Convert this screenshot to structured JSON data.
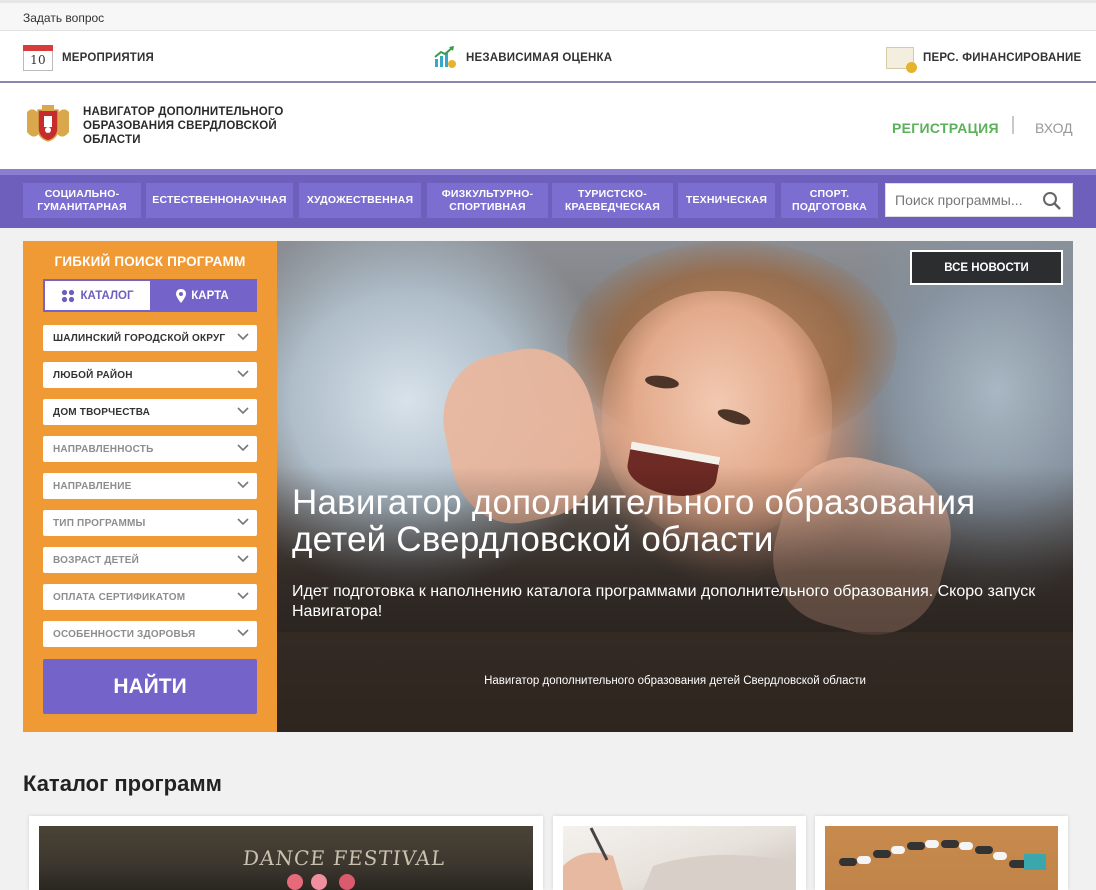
{
  "topbar": {
    "ask_link": "Задать вопрос"
  },
  "services": {
    "events": {
      "label": "МЕРОПРИЯТИЯ",
      "icon": "calendar-icon",
      "day": "10"
    },
    "rating": {
      "label": "НЕЗАВИСИМАЯ ОЦЕНКА",
      "icon": "chart-growth-icon"
    },
    "funding": {
      "label": "ПЕРС. ФИНАНСИРОВАНИЕ",
      "icon": "certificate-icon"
    }
  },
  "header": {
    "logo_icon": "coat-of-arms-icon",
    "logo_text": "НАВИГАТОР ДОПОЛНИТЕЛЬНОГО ОБРАЗОВАНИЯ СВЕРДЛОВСКОЙ ОБЛАСТИ",
    "register_label": "РЕГИСТРАЦИЯ",
    "login_label": "ВХОД",
    "colors": {
      "register": "#5bb15a",
      "login": "#999999"
    }
  },
  "nav": {
    "colors": {
      "bar": "#6e5fbd",
      "item": "#7c6dd0"
    },
    "items": [
      {
        "label": "СОЦИАЛЬНО-\nГУМАНИТАРНАЯ"
      },
      {
        "label": "ЕСТЕСТВЕННОНАУЧНАЯ"
      },
      {
        "label": "ХУДОЖЕСТВЕННАЯ"
      },
      {
        "label": "ФИЗКУЛЬТУРНО-\nСПОРТИВНАЯ"
      },
      {
        "label": "ТУРИСТСКО-\nКРАЕВЕДЧЕСКАЯ"
      },
      {
        "label": "ТЕХНИЧЕСКАЯ"
      },
      {
        "label": "СПОРТ.\nПОДГОТОВКА"
      }
    ],
    "search": {
      "placeholder": "Поиск программы...",
      "icon": "search-icon"
    }
  },
  "sidebar": {
    "color": "#f09a35",
    "title": "ГИБКИЙ ПОИСК ПРОГРАММ",
    "tabs": [
      {
        "label": "КАТАЛОГ",
        "icon": "grid-icon",
        "active": true
      },
      {
        "label": "КАРТА",
        "icon": "map-pin-icon",
        "active": false
      }
    ],
    "filters": [
      {
        "label": "ШАЛИНСКИЙ ГОРОДСКОЙ ОКРУГ",
        "filled": true
      },
      {
        "label": "ЛЮБОЙ РАЙОН",
        "filled": true
      },
      {
        "label": "ДОМ ТВОРЧЕСТВА",
        "filled": true
      },
      {
        "label": "НАПРАВЛЕННОСТЬ",
        "filled": false
      },
      {
        "label": "НАПРАВЛЕНИЕ",
        "filled": false
      },
      {
        "label": "ТИП ПРОГРАММЫ",
        "filled": false
      },
      {
        "label": "ВОЗРАСТ ДЕТЕЙ",
        "filled": false
      },
      {
        "label": "ОПЛАТА СЕРТИФИКАТОМ",
        "filled": false
      },
      {
        "label": "ОСОБЕННОСТИ ЗДОРОВЬЯ",
        "filled": false
      }
    ],
    "find_button": "НАЙТИ",
    "find_color": "#7463c8"
  },
  "hero": {
    "news_button": "ВСЕ НОВОСТИ",
    "title": "Навигатор дополнительного образования детей Свердловской области",
    "text": "Идет подготовка к наполнению каталога программами дополнительного образования. Скоро запуск Навигатора!",
    "caption": "Навигатор дополнительного образования детей Свердловской области"
  },
  "catalog": {
    "title": "Каталог программ",
    "cards": [
      {
        "image_text": "DANCE FESTIVAL"
      },
      {
        "image_text": ""
      },
      {
        "image_text": ""
      }
    ]
  }
}
